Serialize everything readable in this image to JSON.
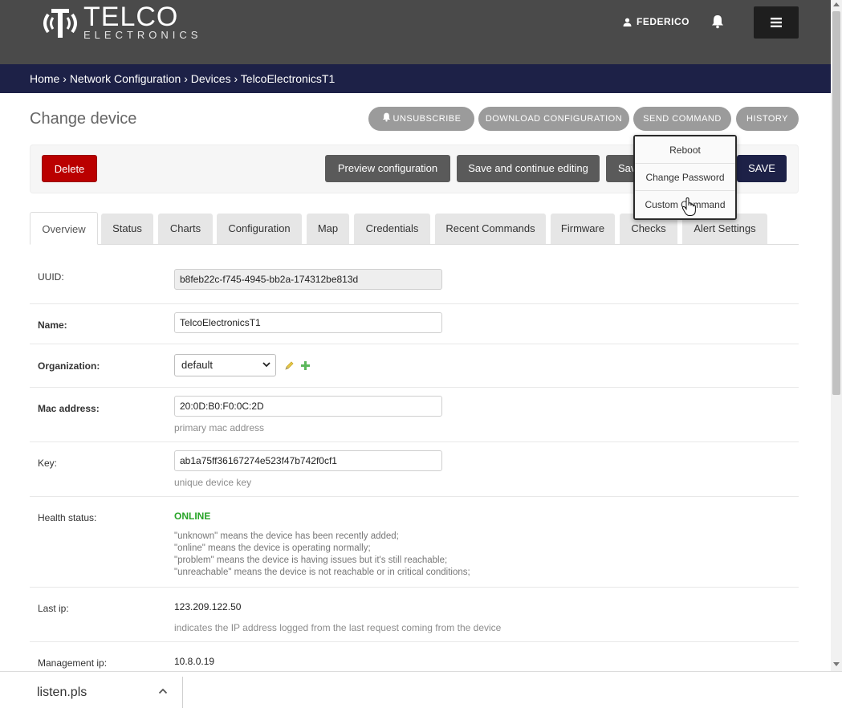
{
  "header": {
    "logo_main": "TELCO",
    "logo_sub": "ELECTRONICS",
    "username": "FEDERICO"
  },
  "breadcrumb": {
    "home": "Home",
    "sep": " › ",
    "section": "Network Configuration",
    "list": "Devices",
    "current": "TelcoElectronicsT1"
  },
  "page": {
    "title": "Change device"
  },
  "top_buttons": {
    "unsubscribe": "UNSUBSCRIBE",
    "download": "DOWNLOAD CONFIGURATION",
    "send_command": "SEND COMMAND",
    "history": "HISTORY"
  },
  "actions": {
    "delete": "Delete",
    "preview": "Preview configuration",
    "save_continue": "Save and continue editing",
    "save_add_partial": "Sav",
    "save": "SAVE"
  },
  "command_menu": {
    "items": [
      "Reboot",
      "Change Password",
      "Custom Command"
    ]
  },
  "tabs": [
    "Overview",
    "Status",
    "Charts",
    "Configuration",
    "Map",
    "Credentials",
    "Recent Commands",
    "Firmware",
    "Checks",
    "Alert Settings"
  ],
  "form": {
    "uuid_label": "UUID:",
    "uuid_value": "b8feb22c-f745-4945-bb2a-174312be813d",
    "name_label": "Name:",
    "name_value": "TelcoElectronicsT1",
    "org_label": "Organization:",
    "org_value": "default",
    "mac_label": "Mac address:",
    "mac_value": "20:0D:B0:F0:0C:2D",
    "mac_help": "primary mac address",
    "key_label": "Key:",
    "key_value": "ab1a75ff36167274e523f47b742f0cf1",
    "key_help": "unique device key",
    "health_label": "Health status:",
    "health_value": "ONLINE",
    "health_help": [
      "\"unknown\" means the device has been recently added;",
      "\"online\" means the device is operating normally;",
      "\"problem\" means the device is having issues but it's still reachable;",
      "\"unreachable\" means the device is not reachable or in critical conditions;"
    ],
    "lastip_label": "Last ip:",
    "lastip_value": "123.209.122.50",
    "lastip_help": "indicates the IP address logged from the last request coming from the device",
    "mgmtip_label": "Management ip:",
    "mgmtip_value": "10.8.0.19"
  },
  "download_bar": {
    "filename": "listen.pls"
  },
  "colors": {
    "header_bg": "#4a4a4a",
    "breadcrumb_bg": "#1d2147",
    "delete_red": "#ba0000",
    "online_green": "#28a428",
    "pill_grey": "#9b9b9b"
  }
}
